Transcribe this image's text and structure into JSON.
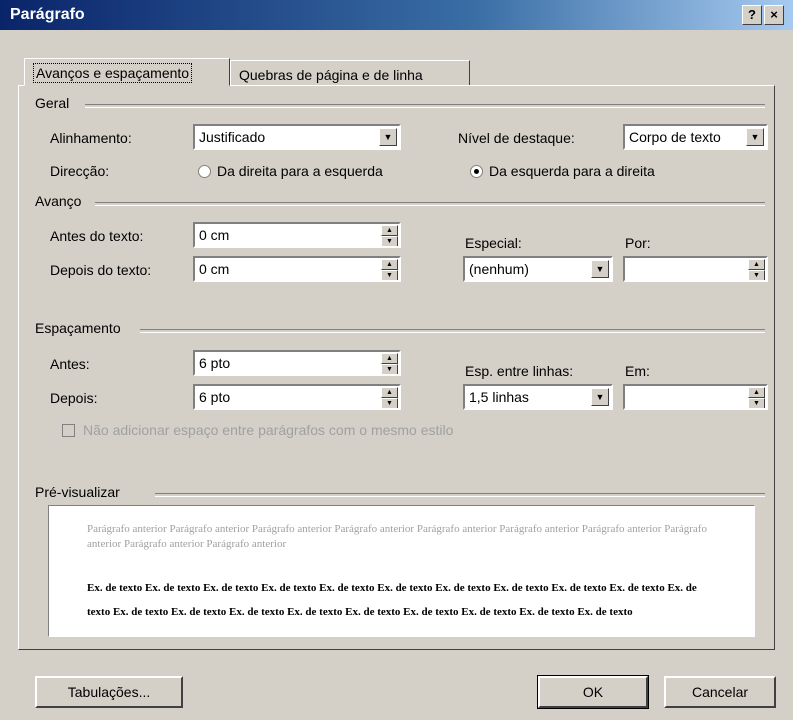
{
  "window": {
    "title": "Parágrafo",
    "help_label": "?",
    "close_label": "×"
  },
  "tabs": [
    {
      "label": "Avanços e espaçamento",
      "active": true
    },
    {
      "label": "Quebras de página e de linha",
      "active": false
    }
  ],
  "general": {
    "group_label": "Geral",
    "alignment_label": "Alinhamento:",
    "alignment_value": "Justificado",
    "outline_label": "Nível de destaque:",
    "outline_value": "Corpo de texto",
    "direction_label": "Direcção:",
    "rtl_label": "Da direita para a esquerda",
    "ltr_label": "Da esquerda para a direita",
    "direction_selected": "ltr"
  },
  "indent": {
    "group_label": "Avanço",
    "before_label": "Antes do texto:",
    "before_value": "0 cm",
    "after_label": "Depois do texto:",
    "after_value": "0 cm",
    "special_label": "Especial:",
    "special_value": "(nenhum)",
    "by_label": "Por:",
    "by_value": ""
  },
  "spacing": {
    "group_label": "Espaçamento",
    "before_label": "Antes:",
    "before_value": "6 pto",
    "after_label": "Depois:",
    "after_value": "6 pto",
    "line_label": "Esp. entre linhas:",
    "line_value": "1,5 linhas",
    "at_label": "Em:",
    "at_value": "",
    "no_space_label": "Não adicionar espaço entre parágrafos com o mesmo estilo"
  },
  "preview": {
    "group_label": "Pré-visualizar",
    "prior_text": "Parágrafo anterior Parágrafo anterior Parágrafo anterior Parágrafo anterior Parágrafo anterior Parágrafo anterior Parágrafo anterior Parágrafo anterior Parágrafo anterior Parágrafo anterior",
    "sample_text": "Ex. de texto Ex. de texto Ex. de texto Ex. de texto Ex. de texto Ex. de texto Ex. de texto Ex. de texto Ex. de texto Ex. de texto Ex. de texto Ex. de texto Ex. de texto Ex. de texto Ex. de texto Ex. de texto Ex. de texto Ex. de texto Ex. de texto Ex. de texto"
  },
  "buttons": {
    "tabs_label": "Tabulações...",
    "ok_label": "OK",
    "cancel_label": "Cancelar"
  }
}
